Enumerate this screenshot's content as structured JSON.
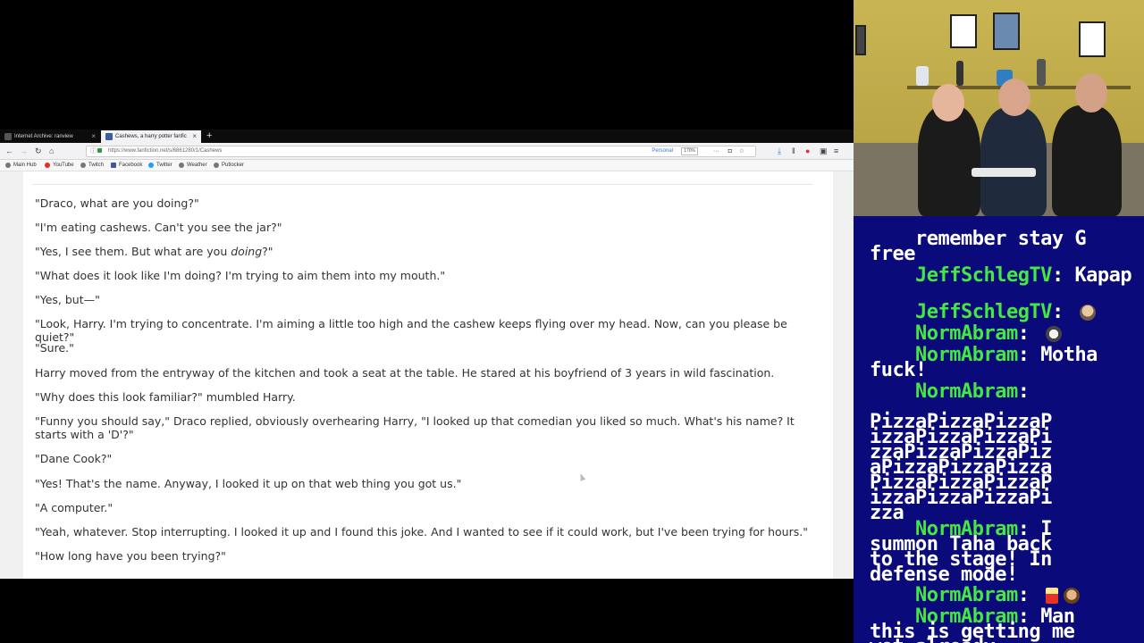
{
  "browser": {
    "tabs": [
      {
        "title": "Internet Archive: ranview",
        "active": false
      },
      {
        "title": "Cashews, a harry potter fanfic",
        "active": true
      }
    ],
    "url": "https://www.fanfiction.net/s/6861280/1/Cashews",
    "personal_label": "Personal",
    "zoom": "170%",
    "bookmarks": [
      "Main Hub",
      "YouTube",
      "Twitch",
      "Facebook",
      "Twitter",
      "Weather",
      "Putlocker"
    ]
  },
  "story": {
    "paragraphs": [
      "\"Draco, what are you doing?\"",
      "\"I'm eating cashews. Can't you see the jar?\"",
      "\"Yes, I see them. But what are you doing?\"",
      "\"What does it look like I'm doing? I'm trying to aim them into my mouth.\"",
      "\"Yes, but—\"",
      "\"Look, Harry. I'm trying to concentrate. I'm aiming a little too high and the cashew keeps flying over my head. Now, can you please be quiet?\"",
      "\"Sure.\"",
      "Harry moved from the entryway of the kitchen and took a seat at the table. He stared at his boyfriend of 3 years in wild fascination.",
      "\"Why does this look familiar?\" mumbled Harry.",
      "\"Funny you should say,\" Draco replied, obviously overhearing Harry, \"I looked up that comedian you liked so much. What's his name? It starts with a 'D'?\"",
      "\"Dane Cook?\"",
      "\"Yes! That's the name. Anyway, I looked it up on that web thing you got us.\"",
      "\"A computer.\"",
      "\"Yeah, whatever. Stop interrupting. I looked it up and I found this joke. And I wanted to see if it could work, but I've been trying for hours.\"",
      "\"How long have you been trying?\""
    ]
  },
  "chat": {
    "messages": [
      {
        "user": "",
        "text": "remember stay G\nfree",
        "emote": ""
      },
      {
        "user": "JeffSchlegTV",
        "text": "Kapap",
        "emote": ""
      },
      {
        "user": "JeffSchlegTV",
        "text": "",
        "emote": "face"
      },
      {
        "user": "NormAbram",
        "text": "",
        "emote": "sheep"
      },
      {
        "user": "NormAbram",
        "text": "Motha\nfuck!",
        "emote": ""
      },
      {
        "user": "NormAbram",
        "text": "PizzaPizzaPizzaP\nizzaPizzaPizzaPi\nzzaPizzaPizzaPiz\naPizzaPizzaPizza\nPizzaPizzaPizzaP\nizzaPizzaPizzaPi\nzza",
        "emote": ""
      },
      {
        "user": "NormAbram",
        "text": "I\nsummon Taha back\nto the stage! In\ndefense mode!",
        "emote": ""
      },
      {
        "user": "NormAbram",
        "text": "",
        "emote": "popcorn man"
      },
      {
        "user": "NormAbram",
        "text": "Man\nthis is getting me\nwet already.",
        "emote": ""
      }
    ]
  },
  "colors": {
    "chat_bg": "#0a0a7a",
    "chat_username": "#43e843",
    "chat_text": "#ffffff"
  }
}
